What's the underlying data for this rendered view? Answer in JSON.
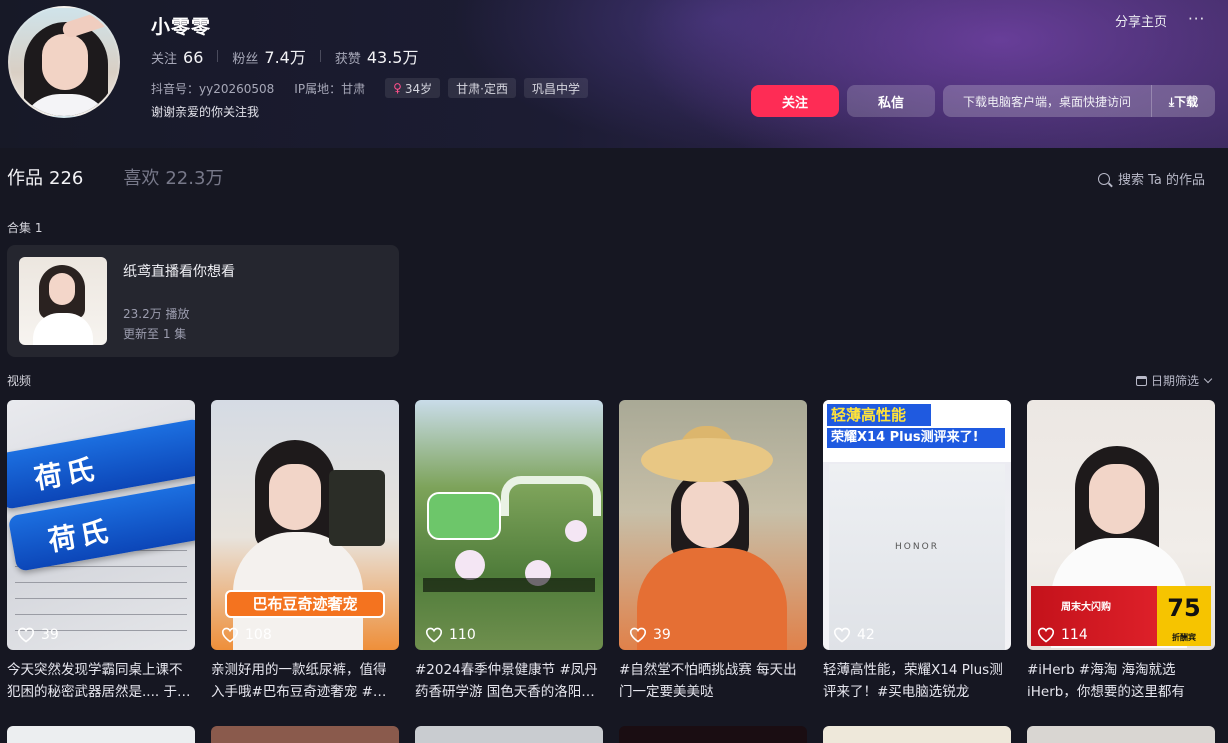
{
  "profile": {
    "nickname": "小零零",
    "stats": [
      {
        "label": "关注",
        "value": "66"
      },
      {
        "label": "粉丝",
        "value": "7.4万"
      },
      {
        "label": "获赞",
        "value": "43.5万"
      }
    ],
    "douyin_id": "抖音号：yy20260508",
    "ip_location": "IP属地：甘肃",
    "tags": {
      "age": "34岁",
      "region": "甘肃·定西",
      "school": "巩昌中学"
    },
    "bio": "谢谢亲爱的你关注我"
  },
  "top_actions": {
    "share": "分享主页",
    "more": "···"
  },
  "actions": {
    "follow": "关注",
    "message": "私信",
    "download_text": "下载电脑客户端，桌面快捷访问",
    "download_btn": "⤓下载"
  },
  "tabs": [
    {
      "label": "作品",
      "count": "226"
    },
    {
      "label": "喜欢",
      "count": "22.3万"
    }
  ],
  "search": {
    "label": "搜索 Ta 的作品"
  },
  "collection": {
    "section_title": "合集 1",
    "title": "纸鸢直播看你想看",
    "plays": "23.2万 播放",
    "update": "更新至 1 集"
  },
  "videos_section": {
    "title": "视频",
    "date_filter": "日期筛选"
  },
  "videos": [
    {
      "likes": "39",
      "title": "今天突然发现学霸同桌上课不犯困的秘密武器居然是.... 于是我也买了"
    },
    {
      "likes": "108",
      "title": "亲测好用的一款纸尿裤，值得入手哦#巴布豆奇迹奢宠 #纸尿裤"
    },
    {
      "likes": "110",
      "title": "#2024春季仲景健康节 #凤丹药香研学游 国色天香的洛阳牡丹"
    },
    {
      "likes": "39",
      "title": "#自然堂不怕晒挑战赛 每天出门一定要美美哒"
    },
    {
      "likes": "42",
      "title": "轻薄高性能，荣耀X14 Plus测评来了！#买电脑选锐龙"
    },
    {
      "likes": "114",
      "title": "#iHerb #海淘 海淘就选iHerb，你想要的这里都有"
    }
  ],
  "thumb_text": {
    "gum": "荷氏",
    "diaper_banner": "巴布豆奇迹奢宠",
    "honor_line1": "轻薄高性能",
    "honor_line2": "荣耀X14 Plus测评来了!",
    "honor_logo": "HONOR",
    "promo_text": "周末大闪购",
    "promo_num": "75",
    "promo_unit": "折酬宾"
  },
  "colors": {
    "accent": "#fe2c55",
    "background": "#161722",
    "card": "#25262f"
  }
}
